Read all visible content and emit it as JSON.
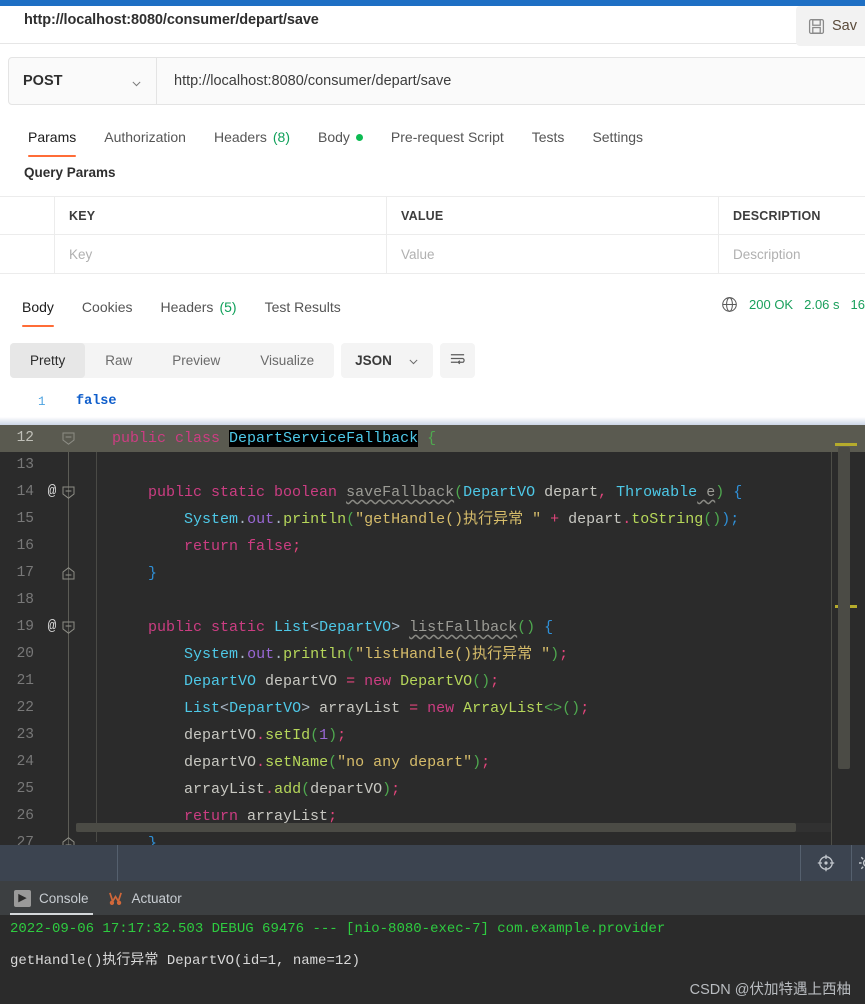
{
  "colors": {
    "accent_blue": "#1e6fc4",
    "postman_orange": "#ff6c37",
    "status_green": "#1aa05c",
    "editor_bg": "#2b2b2b",
    "console_bg": "#2b2b2b",
    "status_bar": "#3c4450"
  },
  "postman": {
    "tab": {
      "url_label": "http://localhost:8080/consumer/depart/save"
    },
    "save_button": {
      "label": "Sav",
      "icon": "save-disk-icon"
    },
    "request": {
      "method": "POST",
      "method_chevron": "chevron-down-icon",
      "url": "http://localhost:8080/consumer/depart/save"
    },
    "request_tabs": [
      {
        "label": "Params",
        "active": true
      },
      {
        "label": "Authorization",
        "active": false
      },
      {
        "label": "Headers",
        "count": "(8)",
        "active": false
      },
      {
        "label": "Body",
        "dot": true,
        "active": false
      },
      {
        "label": "Pre-request Script",
        "active": false
      },
      {
        "label": "Tests",
        "active": false
      },
      {
        "label": "Settings",
        "active": false
      }
    ],
    "query_params": {
      "title": "Query Params",
      "headers": [
        "KEY",
        "VALUE",
        "DESCRIPTION"
      ],
      "row_placeholders": [
        "Key",
        "Value",
        "Description"
      ]
    },
    "response_tabs": [
      {
        "label": "Body",
        "active": true
      },
      {
        "label": "Cookies",
        "active": false
      },
      {
        "label": "Headers",
        "count": "(5)",
        "active": false
      },
      {
        "label": "Test Results",
        "active": false
      }
    ],
    "response_status": {
      "globe_icon": "globe-icon",
      "code": "200 OK",
      "time": "2.06 s",
      "size": "16"
    },
    "view_modes": [
      {
        "label": "Pretty",
        "active": true
      },
      {
        "label": "Raw",
        "active": false
      },
      {
        "label": "Preview",
        "active": false
      },
      {
        "label": "Visualize",
        "active": false
      }
    ],
    "format": {
      "label": "JSON",
      "chevron": "chevron-down-icon"
    },
    "wrap_button": {
      "icon": "word-wrap-icon"
    },
    "response_body": {
      "line_number": "1",
      "value": "false"
    }
  },
  "editor": {
    "lines": [
      {
        "num": "12",
        "current": true,
        "gutter_at": "",
        "fold": "collapse",
        "tokens": [
          {
            "t": "    ",
            "c": "plain"
          },
          {
            "t": "public class ",
            "c": "kw"
          },
          {
            "t": "DepartServiceFallback",
            "c": "hl"
          },
          {
            "t": " {",
            "c": "brk"
          }
        ]
      },
      {
        "num": "13",
        "current": false,
        "gutter_at": "",
        "fold": "",
        "tokens": []
      },
      {
        "num": "14",
        "current": false,
        "gutter_at": "@",
        "fold": "collapse",
        "tokens": [
          {
            "t": "        ",
            "c": "plain"
          },
          {
            "t": "public static boolean ",
            "c": "kw"
          },
          {
            "t": "saveFallback",
            "c": "mtd"
          },
          {
            "t": "(",
            "c": "brk"
          },
          {
            "t": "DepartVO",
            "c": "cls"
          },
          {
            "t": " depart",
            "c": "white"
          },
          {
            "t": ",",
            "c": "pink"
          },
          {
            "t": " ",
            "c": "plain"
          },
          {
            "t": "Throwable",
            "c": "cls"
          },
          {
            "t": " e",
            "c": "mtd"
          },
          {
            "t": ")",
            "c": "brk"
          },
          {
            "t": " {",
            "c": "punc"
          }
        ]
      },
      {
        "num": "15",
        "current": false,
        "gutter_at": "",
        "fold": "",
        "tokens": [
          {
            "t": "            ",
            "c": "plain"
          },
          {
            "t": "System",
            "c": "cls"
          },
          {
            "t": ".",
            "c": "plain"
          },
          {
            "t": "out",
            "c": "num"
          },
          {
            "t": ".",
            "c": "plain"
          },
          {
            "t": "println",
            "c": "mth"
          },
          {
            "t": "(",
            "c": "brk"
          },
          {
            "t": "\"getHandle()执行异常 \"",
            "c": "str"
          },
          {
            "t": " + ",
            "c": "pink"
          },
          {
            "t": "depart",
            "c": "white"
          },
          {
            "t": ".",
            "c": "pink"
          },
          {
            "t": "toString",
            "c": "mth"
          },
          {
            "t": "()",
            "c": "brk"
          },
          {
            "t": ");",
            "c": "punc"
          }
        ]
      },
      {
        "num": "16",
        "current": false,
        "gutter_at": "",
        "fold": "",
        "tokens": [
          {
            "t": "            ",
            "c": "plain"
          },
          {
            "t": "return false",
            "c": "kw"
          },
          {
            "t": ";",
            "c": "pink"
          }
        ]
      },
      {
        "num": "17",
        "current": false,
        "gutter_at": "",
        "fold": "expand",
        "tokens": [
          {
            "t": "        ",
            "c": "plain"
          },
          {
            "t": "}",
            "c": "punc"
          }
        ]
      },
      {
        "num": "18",
        "current": false,
        "gutter_at": "",
        "fold": "",
        "tokens": []
      },
      {
        "num": "19",
        "current": false,
        "gutter_at": "@",
        "fold": "collapse",
        "tokens": [
          {
            "t": "        ",
            "c": "plain"
          },
          {
            "t": "public static ",
            "c": "kw"
          },
          {
            "t": "List",
            "c": "cls"
          },
          {
            "t": "<",
            "c": "plain"
          },
          {
            "t": "DepartVO",
            "c": "cls"
          },
          {
            "t": "> ",
            "c": "plain"
          },
          {
            "t": "listFallback",
            "c": "mtd"
          },
          {
            "t": "()",
            "c": "brk"
          },
          {
            "t": " {",
            "c": "punc"
          }
        ]
      },
      {
        "num": "20",
        "current": false,
        "gutter_at": "",
        "fold": "",
        "tokens": [
          {
            "t": "            ",
            "c": "plain"
          },
          {
            "t": "System",
            "c": "cls"
          },
          {
            "t": ".",
            "c": "plain"
          },
          {
            "t": "out",
            "c": "num"
          },
          {
            "t": ".",
            "c": "plain"
          },
          {
            "t": "println",
            "c": "mth"
          },
          {
            "t": "(",
            "c": "brk"
          },
          {
            "t": "\"listHandle()执行异常 \"",
            "c": "str"
          },
          {
            "t": ")",
            "c": "brk"
          },
          {
            "t": ";",
            "c": "pink"
          }
        ]
      },
      {
        "num": "21",
        "current": false,
        "gutter_at": "",
        "fold": "",
        "tokens": [
          {
            "t": "            ",
            "c": "plain"
          },
          {
            "t": "DepartVO",
            "c": "cls"
          },
          {
            "t": " departVO ",
            "c": "white"
          },
          {
            "t": "=",
            "c": "pink"
          },
          {
            "t": " ",
            "c": "plain"
          },
          {
            "t": "new ",
            "c": "kw"
          },
          {
            "t": "DepartVO",
            "c": "mth"
          },
          {
            "t": "()",
            "c": "brk"
          },
          {
            "t": ";",
            "c": "pink"
          }
        ]
      },
      {
        "num": "22",
        "current": false,
        "gutter_at": "",
        "fold": "",
        "tokens": [
          {
            "t": "            ",
            "c": "plain"
          },
          {
            "t": "List",
            "c": "cls"
          },
          {
            "t": "<",
            "c": "plain"
          },
          {
            "t": "DepartVO",
            "c": "cls"
          },
          {
            "t": "> ",
            "c": "plain"
          },
          {
            "t": "arrayList ",
            "c": "white"
          },
          {
            "t": "=",
            "c": "pink"
          },
          {
            "t": " ",
            "c": "plain"
          },
          {
            "t": "new ",
            "c": "kw"
          },
          {
            "t": "ArrayList",
            "c": "mth"
          },
          {
            "t": "<>()",
            "c": "brk"
          },
          {
            "t": ";",
            "c": "pink"
          }
        ]
      },
      {
        "num": "23",
        "current": false,
        "gutter_at": "",
        "fold": "",
        "tokens": [
          {
            "t": "            ",
            "c": "plain"
          },
          {
            "t": "departVO",
            "c": "white"
          },
          {
            "t": ".",
            "c": "pink"
          },
          {
            "t": "setId",
            "c": "mth"
          },
          {
            "t": "(",
            "c": "brk"
          },
          {
            "t": "1",
            "c": "num"
          },
          {
            "t": ")",
            "c": "brk"
          },
          {
            "t": ";",
            "c": "pink"
          }
        ]
      },
      {
        "num": "24",
        "current": false,
        "gutter_at": "",
        "fold": "",
        "tokens": [
          {
            "t": "            ",
            "c": "plain"
          },
          {
            "t": "departVO",
            "c": "white"
          },
          {
            "t": ".",
            "c": "pink"
          },
          {
            "t": "setName",
            "c": "mth"
          },
          {
            "t": "(",
            "c": "brk"
          },
          {
            "t": "\"no any depart\"",
            "c": "str"
          },
          {
            "t": ")",
            "c": "brk"
          },
          {
            "t": ";",
            "c": "pink"
          }
        ]
      },
      {
        "num": "25",
        "current": false,
        "gutter_at": "",
        "fold": "",
        "tokens": [
          {
            "t": "            ",
            "c": "plain"
          },
          {
            "t": "arrayList",
            "c": "white"
          },
          {
            "t": ".",
            "c": "pink"
          },
          {
            "t": "add",
            "c": "mth"
          },
          {
            "t": "(",
            "c": "brk"
          },
          {
            "t": "departVO",
            "c": "white"
          },
          {
            "t": ")",
            "c": "brk"
          },
          {
            "t": ";",
            "c": "pink"
          }
        ]
      },
      {
        "num": "26",
        "current": false,
        "gutter_at": "",
        "fold": "",
        "tokens": [
          {
            "t": "            ",
            "c": "plain"
          },
          {
            "t": "return ",
            "c": "kw"
          },
          {
            "t": "arrayList",
            "c": "white"
          },
          {
            "t": ";",
            "c": "pink"
          }
        ]
      },
      {
        "num": "27",
        "current": false,
        "gutter_at": "",
        "fold": "expand",
        "tokens": [
          {
            "t": "        ",
            "c": "plain"
          },
          {
            "t": "}",
            "c": "punc"
          }
        ]
      }
    ]
  },
  "console": {
    "tabs": [
      {
        "label": "Console",
        "icon": "run-console-icon",
        "active": true
      },
      {
        "label": "Actuator",
        "icon": "actuator-icon",
        "active": false
      }
    ],
    "log_line_1": "2022-09-06 17:17:32.503 DEBUG 69476 --- [nio-8080-exec-7] com.example.provider",
    "log_line_2": "getHandle()执行异常 DepartVO(id=1, name=12)"
  },
  "status_bar": {
    "locate_icon": "crosshair-icon",
    "settings_icon": "gear-icon"
  },
  "watermark": "CSDN @伏加特遇上西柚"
}
